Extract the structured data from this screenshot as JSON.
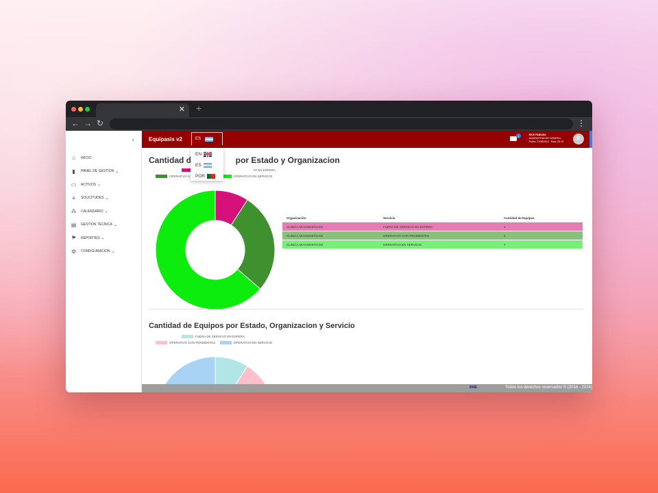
{
  "app": {
    "title": "Equipasis v2"
  },
  "lang": {
    "current": "ES",
    "options": [
      {
        "code": "EN",
        "flag": "uk-flag-icon"
      },
      {
        "code": "ES",
        "flag": "argentina-flag-icon"
      },
      {
        "code": "POR",
        "flag": "portugal-flag-icon"
      }
    ]
  },
  "user": {
    "name": "RIOS FABIANA",
    "role": "ADMINISTRADOR GENERAL",
    "date": "Fecha: 27/06/2024",
    "time": "Hora: 09:13",
    "initial": "R"
  },
  "notifications": {
    "count": "1"
  },
  "sidebar": {
    "items": [
      {
        "label": "INICIO",
        "icon": "home-icon"
      },
      {
        "label": "PANEL DE GESTION",
        "icon": "bar-chart-icon"
      },
      {
        "label": "ACTIVOS",
        "icon": "laptop-icon"
      },
      {
        "label": "SOLICITUDES",
        "icon": "list-check-icon"
      },
      {
        "label": "CALENDARIO",
        "icon": "group-icon"
      },
      {
        "label": "GESTION TECNICA",
        "icon": "document-icon"
      },
      {
        "label": "REPORTES",
        "icon": "flag-icon"
      },
      {
        "label": "CONFIGURACION",
        "icon": "gear-icon"
      }
    ]
  },
  "section1": {
    "title_suffix": "por Estado y Organizacion",
    "title_prefix": "Cantidad de",
    "legend": [
      {
        "label": "FUERA DE SERVICIO EN ESPERA",
        "visible": "IO EN ESPERA",
        "color": "#d6127a"
      },
      {
        "label": "OPERATIVO CON PENDIENTES",
        "visible": "OPERATIVO C",
        "color": "#3f912f"
      },
      {
        "label": "OPERATIVO EN SERVICIO",
        "visible": "OPERATIVO EN SERVICIO",
        "color": "#0ded0d"
      }
    ]
  },
  "table": {
    "headers": [
      "Organización",
      "Servicio",
      "Cantidad de Equipos"
    ],
    "rows": [
      {
        "org": "CLINICA DIAGNOSTICOS",
        "service": "FUERA DE SERVICIO EN ESPERA",
        "count": "1",
        "color": "#e67cb4"
      },
      {
        "org": "CLINICA DIAGNOSTICOS",
        "service": "OPERATIVO CON PENDIENTES",
        "count": "3",
        "color": "#8bbf7e"
      },
      {
        "org": "CLINICA DIAGNOSTICOS",
        "service": "OPERATIVO EN SERVICIO",
        "count": "7",
        "color": "#78f078"
      }
    ]
  },
  "section2": {
    "title": "Cantidad de Equipos por Estado, Organizacion y Servicio",
    "legend": [
      {
        "label": "FUERA DE SERVICIO EN ESPERA",
        "color": "#b2e6e6"
      },
      {
        "label": "OPERATIVO CON PENDIENTES",
        "color": "#ffc0cb"
      },
      {
        "label": "OPERATIVO EN SERVICIO",
        "color": "#a9d3f5"
      }
    ]
  },
  "chart_data": [
    {
      "type": "pie",
      "categories": [
        "FUERA DE SERVICIO EN ESPERA",
        "OPERATIVO CON PENDIENTES",
        "OPERATIVO EN SERVICIO"
      ],
      "values": [
        1,
        3,
        7
      ],
      "colors": [
        "#d6127a",
        "#3f912f",
        "#0ded0d"
      ],
      "donut": true
    },
    {
      "type": "pie",
      "categories": [
        "FUERA DE SERVICIO EN ESPERA",
        "OPERATIVO CON PENDIENTES",
        "OPERATIVO EN SERVICIO"
      ],
      "values": [
        1,
        3,
        7
      ],
      "colors": [
        "#b2e6e6",
        "#ffc0cb",
        "#a9d3f5"
      ]
    }
  ],
  "footer": {
    "logo": "BME",
    "copyright": "Todos los derechos reservados © (2016 - 2024)"
  }
}
